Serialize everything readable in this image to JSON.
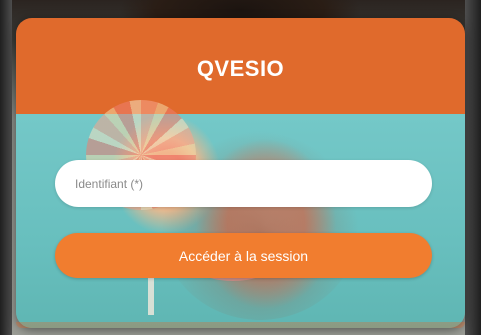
{
  "app": {
    "title": "QVESIO"
  },
  "login": {
    "identifier_placeholder": "Identifiant (*)",
    "identifier_value": "",
    "submit_label": "Accéder à la session"
  },
  "colors": {
    "header": "#e06a2c",
    "button": "#f17d2f",
    "background_teal": "#68bfbe"
  }
}
